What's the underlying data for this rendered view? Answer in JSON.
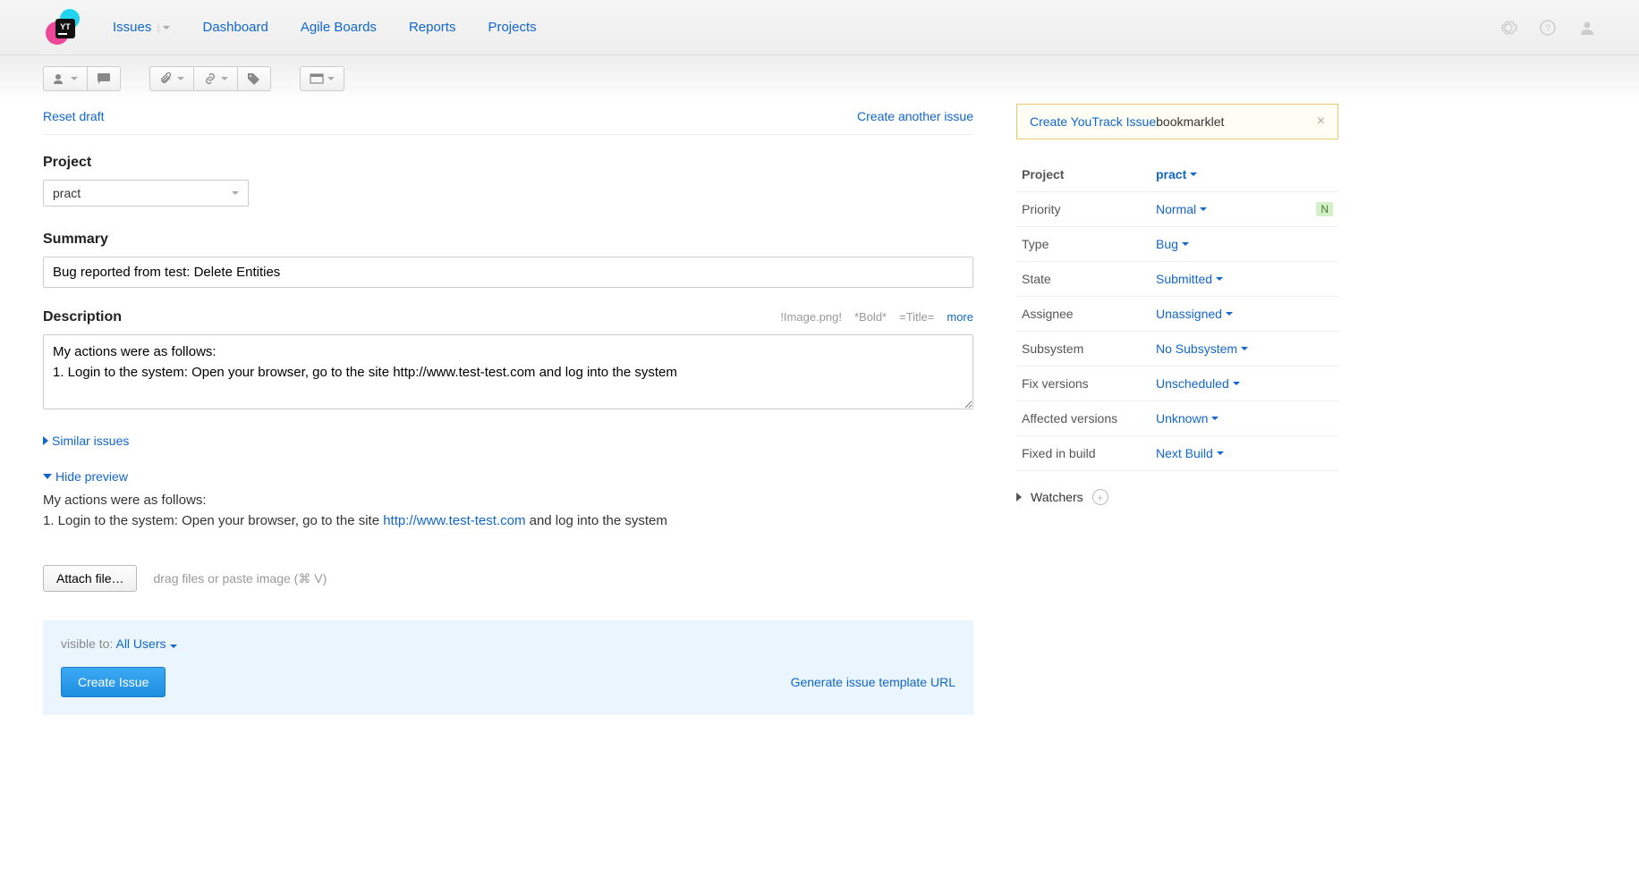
{
  "nav": {
    "issues": "Issues",
    "dashboard": "Dashboard",
    "agile": "Agile Boards",
    "reports": "Reports",
    "projects": "Projects"
  },
  "actions": {
    "reset": "Reset draft",
    "create_another": "Create another issue"
  },
  "project": {
    "label": "Project",
    "value": "pract"
  },
  "summary": {
    "label": "Summary",
    "value": "Bug reported from test: Delete Entities"
  },
  "description": {
    "label": "Description",
    "hints": {
      "image": "!Image.png!",
      "bold": "*Bold*",
      "title": "=Title=",
      "more": "more"
    },
    "value": "My actions were as follows:\n1. Login to the system: Open your browser, go to the site http://www.test-test.com and log into the system"
  },
  "similar": "Similar issues",
  "hide_preview": "Hide preview",
  "preview": {
    "line1": "My actions were as follows:",
    "line2_a": "1. Login to the system: Open your browser, go to the site ",
    "line2_link": "http://www.test-test.com",
    "line2_b": " and log into the system"
  },
  "attach": {
    "button": "Attach file…",
    "hint": "drag files or paste image (⌘ V)"
  },
  "visible": {
    "label": "visible to:",
    "value": "All Users"
  },
  "footer": {
    "create": "Create Issue",
    "template": "Generate issue template URL"
  },
  "bookmarklet": {
    "link": "Create YouTrack Issue",
    "suffix": " bookmarklet"
  },
  "props": {
    "project": {
      "label": "Project",
      "value": "pract"
    },
    "priority": {
      "label": "Priority",
      "value": "Normal",
      "badge": "N"
    },
    "type": {
      "label": "Type",
      "value": "Bug"
    },
    "state": {
      "label": "State",
      "value": "Submitted"
    },
    "assignee": {
      "label": "Assignee",
      "value": "Unassigned"
    },
    "subsystem": {
      "label": "Subsystem",
      "value": "No Subsystem"
    },
    "fix_versions": {
      "label": "Fix versions",
      "value": "Unscheduled"
    },
    "affected_versions": {
      "label": "Affected versions",
      "value": "Unknown"
    },
    "fixed_in_build": {
      "label": "Fixed in build",
      "value": "Next Build"
    }
  },
  "watchers": "Watchers"
}
